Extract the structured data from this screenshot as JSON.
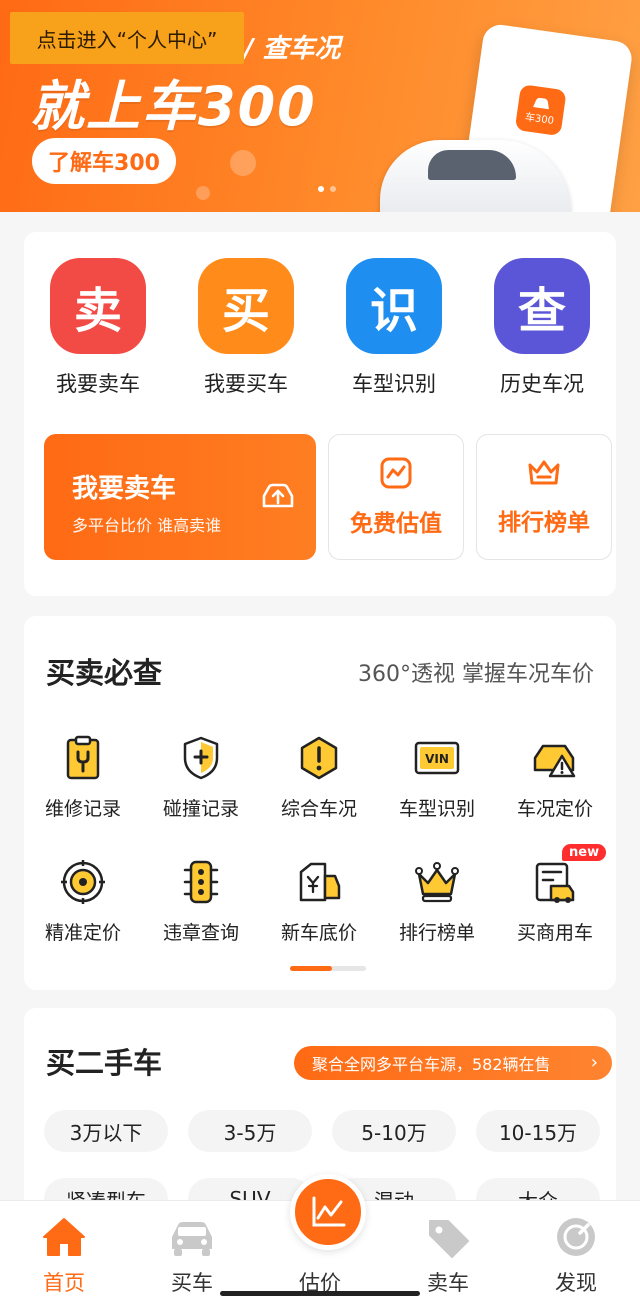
{
  "banner": {
    "tooltip": "点击进入“个人中心”",
    "subtitle": "/ 查车况",
    "title": "就上车300",
    "cta": "了解车300",
    "app_icon_text": "车300",
    "brand_color": "#ff6a14"
  },
  "quick_entries": [
    {
      "glyph": "卖",
      "label": "我要卖车",
      "color": "#f24b45"
    },
    {
      "glyph": "买",
      "label": "我要买车",
      "color": "#ff8c1a"
    },
    {
      "glyph": "识",
      "label": "车型识别",
      "color": "#1e8ff0"
    },
    {
      "glyph": "查",
      "label": "历史车况",
      "color": "#5b56d8"
    }
  ],
  "sell_card": {
    "title": "我要卖车",
    "subtitle": "多平台比价 谁高卖谁"
  },
  "small_cards": [
    {
      "label": "免费估值",
      "icon": "chart-trend-icon"
    },
    {
      "label": "排行榜单",
      "icon": "crown-icon"
    }
  ],
  "check_section": {
    "title": "买卖必查",
    "subtitle": "360°透视 掌握车况车价",
    "row1": [
      {
        "label": "维修记录",
        "icon": "maintenance-clipboard-icon"
      },
      {
        "label": "碰撞记录",
        "icon": "collision-shield-icon"
      },
      {
        "label": "综合车况",
        "icon": "hexagon-alert-icon"
      },
      {
        "label": "车型识别",
        "icon": "vin-icon",
        "vin": "VIN"
      },
      {
        "label": "车况定价",
        "icon": "car-warning-icon"
      }
    ],
    "row2": [
      {
        "label": "精准定价",
        "icon": "target-icon"
      },
      {
        "label": "违章查询",
        "icon": "traffic-light-icon"
      },
      {
        "label": "新车底价",
        "icon": "price-tag-icon"
      },
      {
        "label": "排行榜单",
        "icon": "crown-ranking-icon"
      },
      {
        "label": "买商用车",
        "icon": "commercial-vehicle-icon",
        "badge": "new"
      }
    ],
    "scroll_progress": 0.55
  },
  "used_cars": {
    "title": "买二手车",
    "promo": "聚合全网多平台车源，582辆在售",
    "price_filters": [
      "3万以下",
      "3-5万",
      "5-10万",
      "10-15万"
    ],
    "type_filters": [
      "紧凑型车",
      "SUV",
      "混动",
      "大众"
    ]
  },
  "tabbar": {
    "tabs": [
      {
        "label": "首页",
        "icon": "home-icon",
        "active": true
      },
      {
        "label": "买车",
        "icon": "car-icon",
        "active": false
      },
      {
        "label": "估价",
        "icon": "chart-icon",
        "active": false
      },
      {
        "label": "卖车",
        "icon": "tag-icon",
        "active": false
      },
      {
        "label": "发现",
        "icon": "compass-icon",
        "active": false
      }
    ]
  }
}
